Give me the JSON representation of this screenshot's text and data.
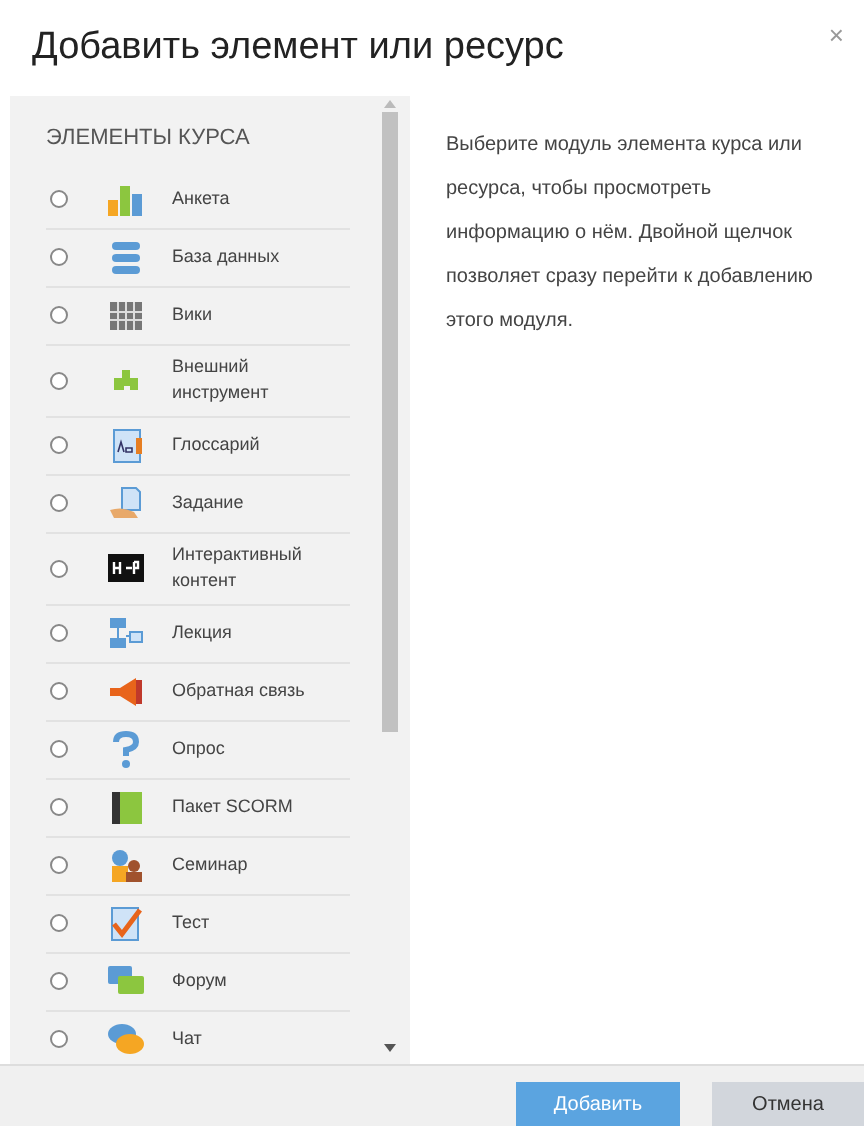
{
  "dialog": {
    "title": "Добавить элемент или ресурс",
    "close": "×"
  },
  "list": {
    "heading": "ЭЛЕМЕНТЫ КУРСА",
    "items": [
      {
        "label": "Анкета",
        "selected": false
      },
      {
        "label": "База данных",
        "selected": false
      },
      {
        "label": "Вики",
        "selected": false
      },
      {
        "label": "Внешний инструмент",
        "selected": false
      },
      {
        "label": "Глоссарий",
        "selected": false
      },
      {
        "label": "Задание",
        "selected": false
      },
      {
        "label": "Интерактивный контент",
        "selected": false
      },
      {
        "label": "Лекция",
        "selected": false
      },
      {
        "label": "Обратная связь",
        "selected": false
      },
      {
        "label": "Опрос",
        "selected": false
      },
      {
        "label": "Пакет SCORM",
        "selected": false
      },
      {
        "label": "Семинар",
        "selected": false
      },
      {
        "label": "Тест",
        "selected": false
      },
      {
        "label": "Форум",
        "selected": false
      },
      {
        "label": "Чат",
        "selected": false
      }
    ]
  },
  "info": "Выберите модуль элемента курса или ресурса, чтобы просмотреть информацию о нём. Двойной щелчок позволяет сразу перейти к добавлению этого модуля.",
  "buttons": [
    {
      "label": "Добавить",
      "kind": "primary"
    },
    {
      "label": "Отмена",
      "kind": "secondary"
    }
  ]
}
